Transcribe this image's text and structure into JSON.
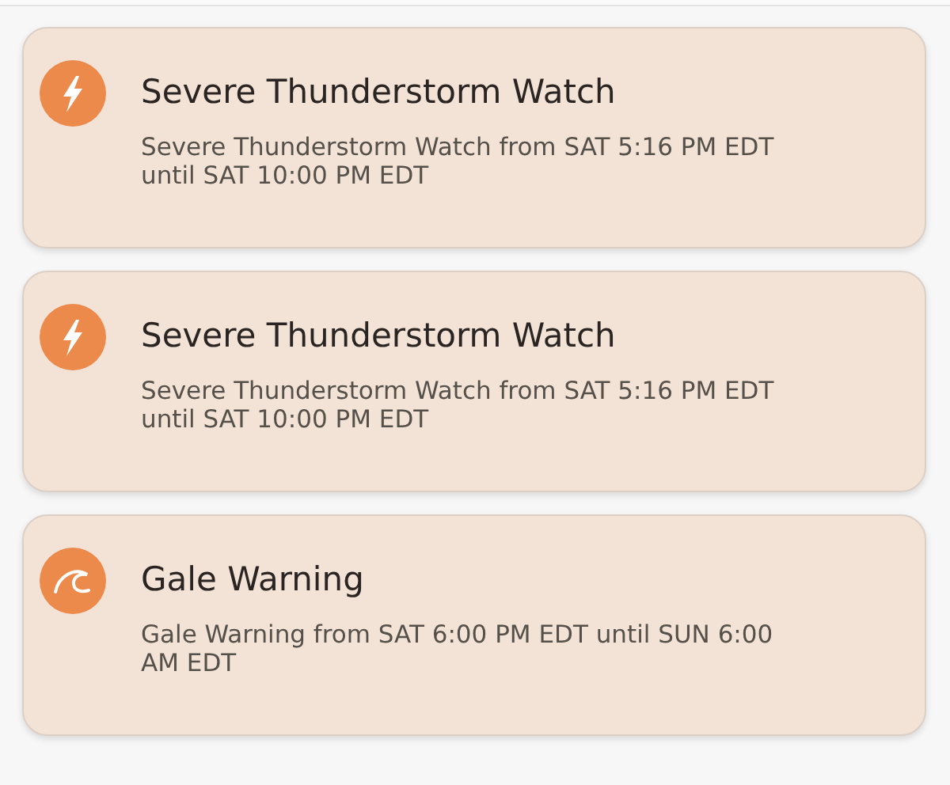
{
  "alerts": [
    {
      "kind": "thunderstorm",
      "title": "Severe Thunderstorm Watch",
      "description_lines": [
        "Severe Thunderstorm Watch from SAT 5:16 PM EDT",
        "until SAT 10:00 PM EDT"
      ]
    },
    {
      "kind": "thunderstorm",
      "title": "Severe Thunderstorm Watch",
      "description_lines": [
        "Severe Thunderstorm Watch from SAT 5:16 PM EDT",
        "until SAT 10:00 PM EDT"
      ]
    },
    {
      "kind": "wave",
      "title": "Gale Warning",
      "description_lines": [
        "Gale Warning from SAT 6:00 PM EDT until SUN 6:00",
        "AM EDT"
      ]
    }
  ]
}
